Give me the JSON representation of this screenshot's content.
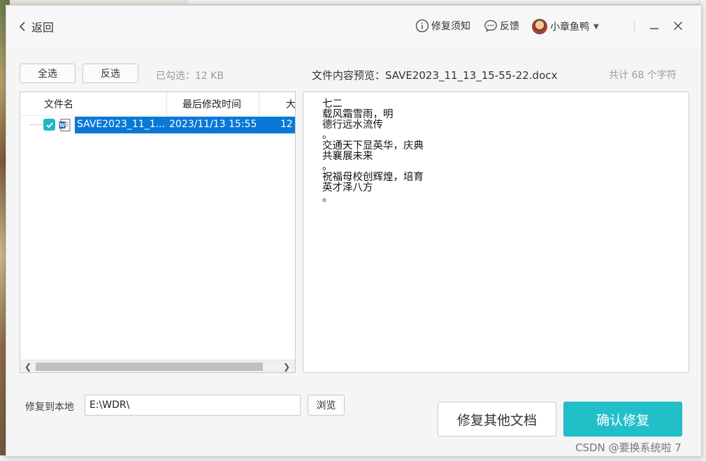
{
  "titlebar": {
    "back_label": "返回",
    "repair_notice_label": "修复须知",
    "feedback_label": "反馈",
    "user_name": "小章鱼鸭"
  },
  "toolbar": {
    "select_all_label": "全选",
    "invert_label": "反选",
    "selected_info": "已勾选：12 KB",
    "preview_label": "文件内容预览：SAVE2023_11_13_15-55-22.docx",
    "char_count": "共计 68 个字符"
  },
  "file_table": {
    "headers": [
      "文件名",
      "最后修改时间",
      "大"
    ],
    "rows": [
      {
        "name": "SAVE2023_11_1...",
        "modified": "2023/11/13 15:55",
        "size": "12",
        "checked": true
      }
    ]
  },
  "preview_lines": [
    "七二",
    "载风霜雪雨，明",
    "德行远水流传",
    "。",
    "交通天下显英华，庆典",
    "共襄展未来",
    "。",
    "祝福母校创辉煌，培育",
    "英才泽八方",
    "。"
  ],
  "bottom": {
    "dest_label": "修复到本地",
    "dest_value": "E:\\WDR\\",
    "browse_label": "浏览",
    "repair_other_label": "修复其他文档",
    "confirm_label": "确认修复"
  },
  "watermark": "CSDN @要换系统啦 7",
  "colors": {
    "accent": "#21c0c8",
    "selection": "#0a78d7",
    "checkbox": "#21b7c2"
  }
}
